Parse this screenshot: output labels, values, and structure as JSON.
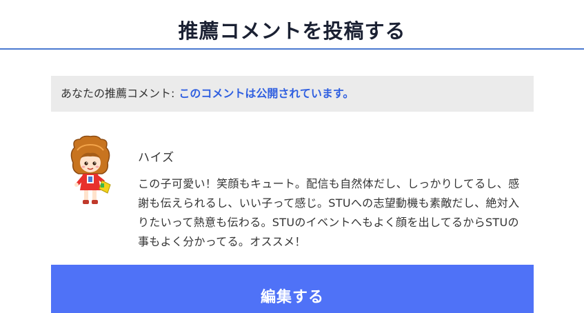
{
  "header": {
    "title": "推薦コメントを投稿する"
  },
  "status": {
    "label": "あなたの推薦コメント:",
    "message": "このコメントは公開されています。"
  },
  "comment": {
    "avatar_icon": "character-avatar-icon",
    "username": "ハイズ",
    "body": "この子可愛い！笑顔もキュート。配信も自然体だし、しっかりしてるし、感謝も伝えられるし、いい子って感じ。STUへの志望動機も素敵だし、絶対入りたいって熱意も伝わる。STUのイベントへもよく顔を出してるからSTUの事もよく分かってる。オススメ！"
  },
  "actions": {
    "edit_label": "編集する"
  },
  "colors": {
    "accent": "#4a78d0",
    "link": "#2f5fe0",
    "button": "#4f72f7",
    "status_bg": "#ebebeb"
  }
}
